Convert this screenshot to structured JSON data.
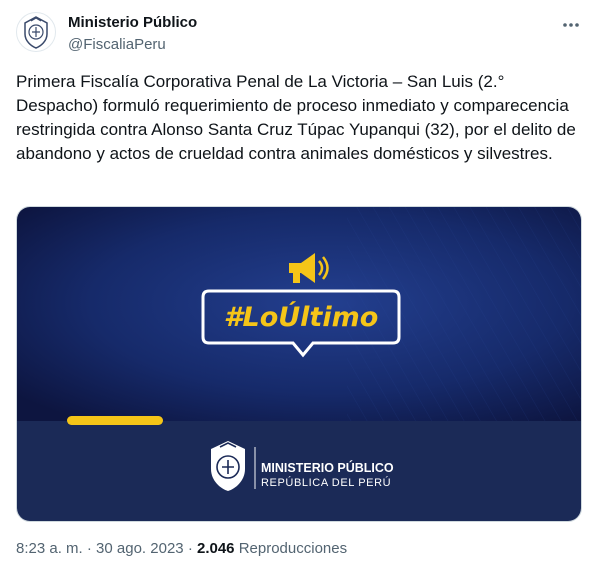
{
  "author": {
    "name": "Ministerio Público",
    "handle": "@FiscaliaPeru",
    "avatar_icon": "government-seal-icon"
  },
  "more_icon": "more-horizontal-icon",
  "tweet": {
    "text": "Primera Fiscalía Corporativa Penal de La Victoria – San Luis (2.° Despacho) formuló requerimiento de proceso inmediato y comparecencia restringida contra Alonso Santa Cruz Túpac Yupanqui (32), por el delito de abandono y actos de crueldad contra animales domésticos y silvestres."
  },
  "media": {
    "hashtag": "#LoÚltimo",
    "megaphone_icon": "megaphone-icon",
    "org_line1": "MINISTERIO PÚBLICO",
    "org_line2": "REPÚBLICA DEL PERÚ",
    "colors": {
      "bg_dark": "#10194a",
      "bg_light": "#1f3d8a",
      "band": "#1b2a57",
      "accent": "#f5c518",
      "text_light": "#ffffff"
    }
  },
  "meta": {
    "time": "8:23 a. m.",
    "separator": "·",
    "date": "30 ago. 2023",
    "views_count": "2.046",
    "views_label": "Reproducciones"
  }
}
